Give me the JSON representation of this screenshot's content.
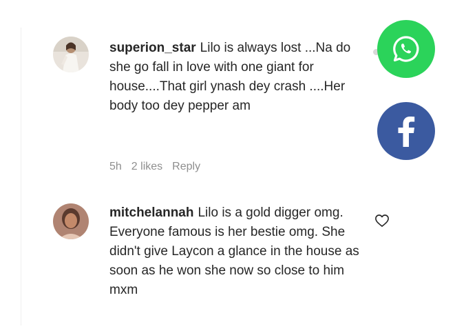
{
  "comments": [
    {
      "username": "superion_star",
      "text": "Lilo is always lost ...Na do she go fall in love with one giant for house....That girl ynash dey crash ....Her body too dey pepper am",
      "time": "5h",
      "likes": "2 likes",
      "reply_label": "Reply",
      "avatar_icon": "avatar-woman-white-dress"
    },
    {
      "username": "mitchelannah",
      "text": "Lilo is a gold digger omg. Everyone famous is her bestie omg. She didn't give Laycon a glance in the house as soon as he won she now so close to him mxm",
      "avatar_icon": "avatar-woman-portrait",
      "like_icon": "heart-outline-icon"
    }
  ],
  "share": {
    "whatsapp": {
      "icon": "whatsapp-icon",
      "color": "#2bd35a"
    },
    "facebook": {
      "icon": "facebook-icon",
      "color": "#3b5aa0"
    }
  }
}
